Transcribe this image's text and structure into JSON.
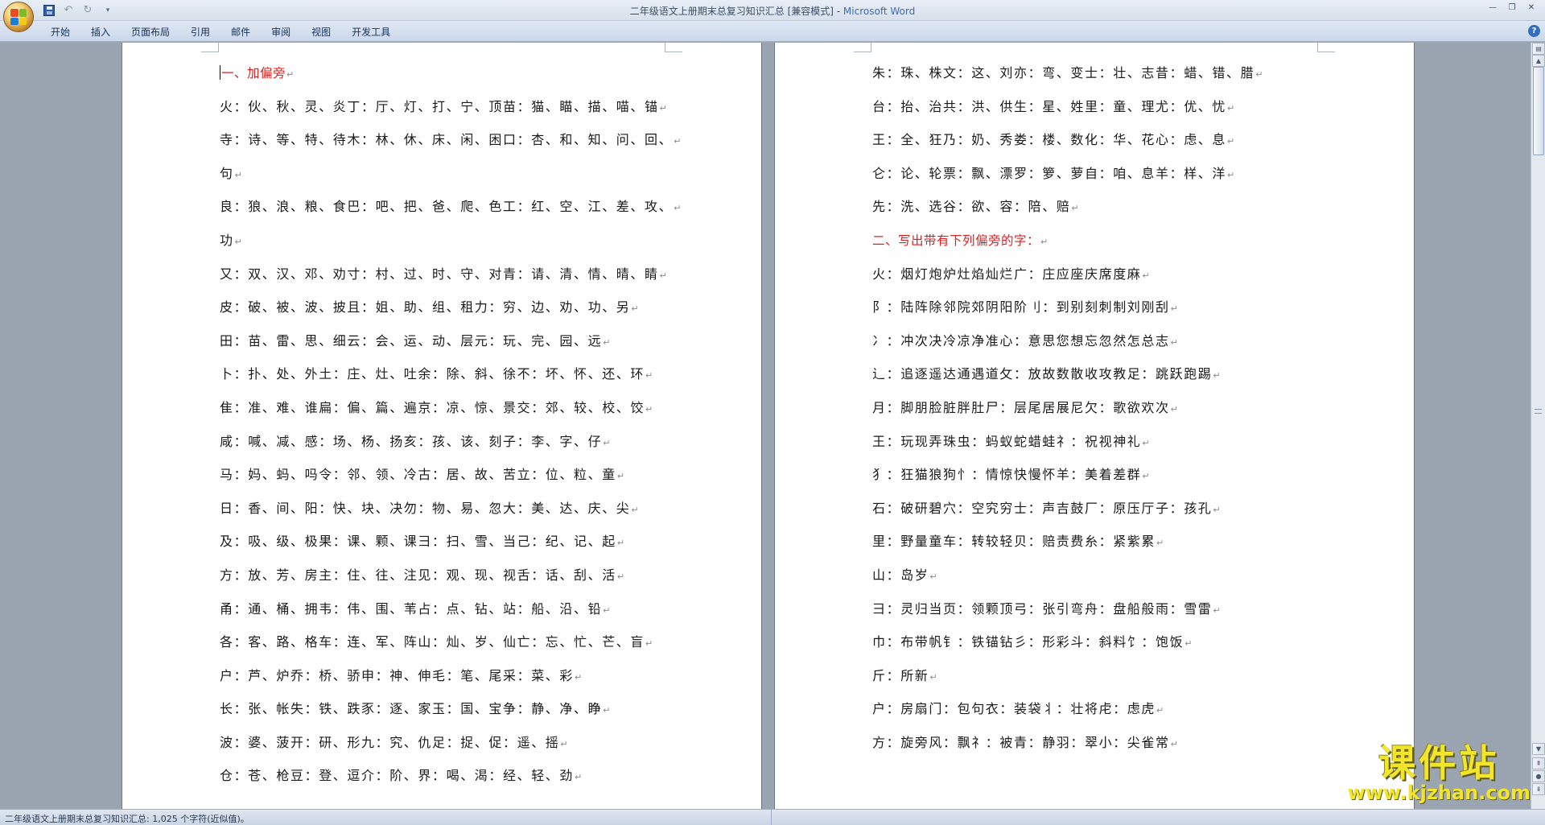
{
  "window": {
    "title_doc": "二年级语文上册期末总复习知识汇总 [兼容模式] - ",
    "title_app": "Microsoft Word"
  },
  "ribbon": {
    "tabs": [
      "开始",
      "插入",
      "页面布局",
      "引用",
      "邮件",
      "审阅",
      "视图",
      "开发工具"
    ]
  },
  "document": {
    "left_page": [
      {
        "text": "一、加偏旁",
        "heading": true
      },
      {
        "text": "火：伙、秋、灵、炎丁：厅、灯、打、宁、顶苗：猫、瞄、描、喵、锚"
      },
      {
        "text": "寺：诗、等、特、待木：林、休、床、闲、困口：杏、和、知、问、回、"
      },
      {
        "text": "句"
      },
      {
        "text": "良：狼、浪、粮、食巴：吧、把、爸、爬、色工：红、空、江、差、攻、"
      },
      {
        "text": "功"
      },
      {
        "text": "又：双、汉、邓、劝寸：村、过、时、守、对青：请、清、情、晴、睛"
      },
      {
        "text": "皮：破、被、波、披且：姐、助、组、租力：穷、边、劝、功、另"
      },
      {
        "text": "田：苗、雷、思、细云：会、运、动、层元：玩、完、园、远"
      },
      {
        "text": "卜：扑、处、外土：庄、灶、吐余：除、斜、徐不：坏、怀、还、环"
      },
      {
        "text": "隹：准、难、谁扁：偏、篇、遍京：凉、惊、景交：郊、较、校、饺"
      },
      {
        "text": "咸：喊、减、感：场、杨、扬亥：孩、该、刻子：李、字、仔"
      },
      {
        "text": "马：妈、蚂、吗令：邻、领、冷古：居、故、苦立：位、粒、童"
      },
      {
        "text": "日：香、间、阳：快、块、决勿：物、易、忽大：美、达、庆、尖"
      },
      {
        "text": "及：吸、级、极果：课、颗、课彐：扫、雪、当己：纪、记、起"
      },
      {
        "text": "方：放、芳、房主：住、往、注见：观、现、视舌：话、刮、活"
      },
      {
        "text": "甬：通、桶、拥韦：伟、围、苇占：点、钻、站：船、沿、铅"
      },
      {
        "text": "各：客、路、格车：连、军、阵山：灿、岁、仙亡：忘、忙、芒、盲"
      },
      {
        "text": "户：芦、炉乔：桥、骄申：神、伸毛：笔、尾采：菜、彩"
      },
      {
        "text": "长：张、帐失：铁、跌豕：逐、家玉：国、宝争：静、净、睁"
      },
      {
        "text": "波：婆、菠开：研、形九：究、仇足：捉、促：遥、摇"
      },
      {
        "text": "仓：苍、枪豆：登、逗介：阶、界：喝、渴：经、轻、劲"
      }
    ],
    "right_page": [
      {
        "text": "朱：珠、株文：这、刘亦：弯、变士：壮、志昔：蜡、错、腊"
      },
      {
        "text": "台：抬、治共：洪、供生：星、姓里：童、理尤：优、忧"
      },
      {
        "text": "王：全、狂乃：奶、秀娄：楼、数化：华、花心：虑、息"
      },
      {
        "text": "仑：论、轮票：飘、漂罗：箩、萝自：咱、息羊：样、洋"
      },
      {
        "text": "先：洗、选谷：欲、容：陪、赔"
      },
      {
        "text": "二、写出带有下列偏旁的字：",
        "heading": true
      },
      {
        "text": "火：烟灯炮炉灶焰灿烂广：庄应座庆席度麻"
      },
      {
        "text": "阝：陆阵除邻院郊阴阳阶刂：到别刻刺制刘刚刮"
      },
      {
        "text": "冫：冲次决冷凉净准心：意思您想忘忽然怎总志"
      },
      {
        "text": "辶：追逐遥达通遇道攵：放故数散收攻教足：跳跃跑踢"
      },
      {
        "text": "月：脚朋脸脏胖肚尸：层尾居展尼欠：歌欲欢次"
      },
      {
        "text": "王：玩现弄珠虫：蚂蚁蛇蜡蛙礻：祝视神礼"
      },
      {
        "text": "犭：狂猫狼狗忄：情惊快慢怀羊：美着差群"
      },
      {
        "text": "石：破研碧穴：空究穷士：声吉鼓厂：原压厅子：孩孔"
      },
      {
        "text": "里：野量童车：转较轻贝：赔责费糸：紧紫累"
      },
      {
        "text": "山：岛岁"
      },
      {
        "text": "彐：灵归当页：领颗顶弓：张引弯舟：盘船般雨：雪雷"
      },
      {
        "text": "巾：布带帆钅：铁锚钻彡：形彩斗：斜料饣：饱饭"
      },
      {
        "text": "斤：所新"
      },
      {
        "text": "户：房扇门：包句衣：装袋丬：壮将虍：虑虎"
      },
      {
        "text": "方：旋旁风：飘礻：被青：静羽：翠小：尖雀常"
      }
    ]
  },
  "status": {
    "text": "二年级语文上册期末总复习知识汇总: 1,025 个字符(近似值)。"
  },
  "watermark": {
    "main": "课件站",
    "url": "www.kjzhan.com"
  },
  "colors": {
    "heading": "#e11f1f",
    "title_app": "#3a6bb5"
  }
}
